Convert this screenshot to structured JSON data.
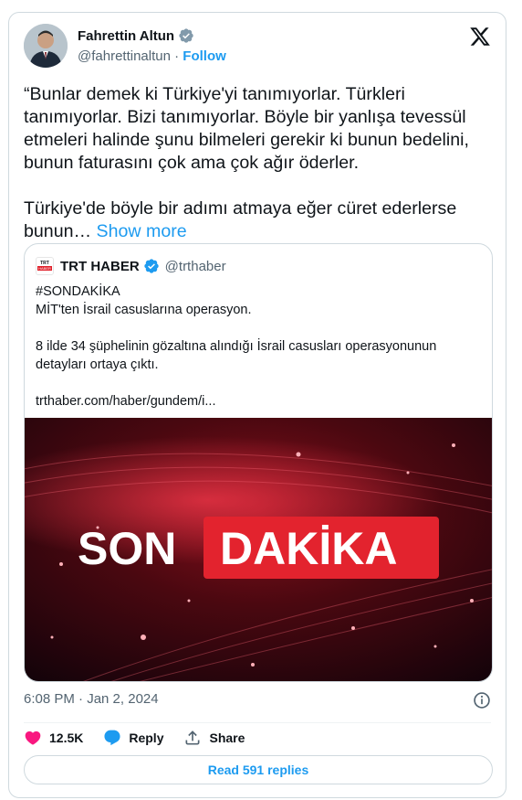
{
  "author": {
    "name": "Fahrettin Altun",
    "handle": "@fahrettinaltun",
    "separator": "·",
    "follow_label": "Follow"
  },
  "tweet": {
    "text": "“Bunlar demek ki Türkiye'yi tanımıyorlar. Türkleri tanımıyorlar. Bizi tanımıyorlar. Böyle bir yanlışa tevessül etmeleri halinde şunu bilmeleri gerekir ki bunun bedelini, bunun faturasını çok ama çok ağır öderler.\n\nTürkiye'de böyle bir adımı atmaya eğer cüret ederlerse bunun…",
    "show_more": "Show more",
    "timestamp": "6:08 PM · Jan 2, 2024"
  },
  "quoted": {
    "logo_line1": "TRT",
    "logo_line2": "HABER",
    "name": "TRT HABER",
    "handle": "@trthaber",
    "text": "#SONDAKİKA\nMİT'ten İsrail casuslarına operasyon.\n\n8 ilde 34 şüphelinin gözaltına alındığı İsrail casusları operasyonunun detayları ortaya çıktı.\n\ntrthaber.com/haber/gundem/i...",
    "image_text_left": "SON",
    "image_text_right": "DAKİKA"
  },
  "actions": {
    "likes": "12.5K",
    "reply_label": "Reply",
    "share_label": "Share",
    "read_replies": "Read 591 replies"
  },
  "icons": {
    "verified": "verified-badge-icon",
    "x_logo": "x-logo-icon",
    "info": "info-icon",
    "heart": "heart-icon",
    "reply": "reply-bubble-icon",
    "share": "share-icon"
  },
  "colors": {
    "link": "#1d9bf0",
    "like": "#f91880",
    "secondary_text": "#536471",
    "border": "#cfd9de",
    "breaking_red": "#e3232e"
  }
}
